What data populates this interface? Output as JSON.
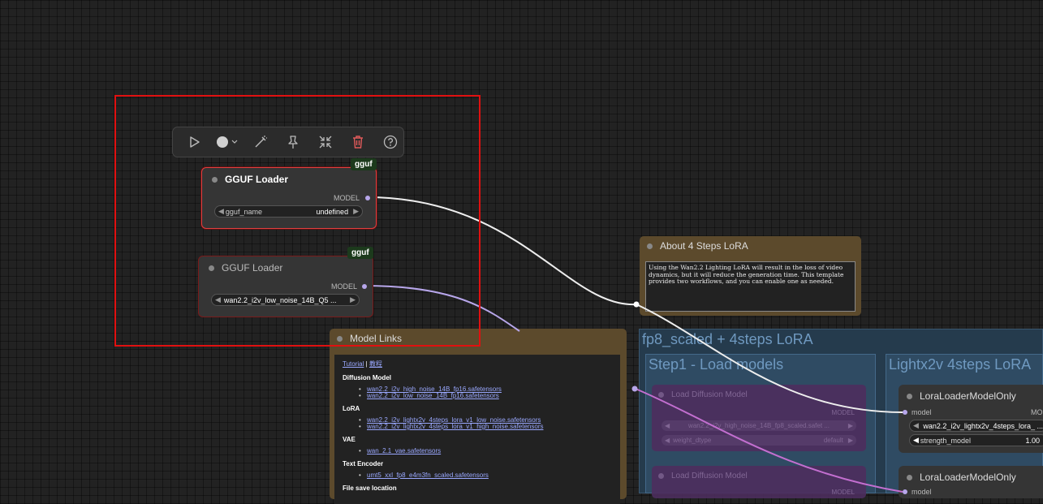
{
  "toolbar": {
    "run_icon": "play-icon",
    "color_icon": "color-dot-icon",
    "bypass_icon": "wand-icon",
    "pin_icon": "pin-icon",
    "collapse_icon": "collapse-icon",
    "delete_icon": "trash-icon",
    "help_icon": "help-icon"
  },
  "nodes": {
    "gguf1": {
      "badge": "gguf",
      "title": "GGUF Loader",
      "output": "MODEL",
      "widget_name": "gguf_name",
      "widget_value": "undefined"
    },
    "gguf2": {
      "badge": "gguf",
      "title": "GGUF Loader",
      "output": "MODEL",
      "widget_value": "wan2.2_i2v_low_noise_14B_Q5 ..."
    }
  },
  "about_note": {
    "title": "About 4 Steps LoRA",
    "text": "Using the Wan2.2 Lighting LoRA will result in the loss of video dynamics, but it will reduce the generation time. This template provides two workflows, and you can enable one as needed."
  },
  "model_links": {
    "title": "Model Links",
    "tutorial": "Tutorial",
    "sep": "|",
    "tutorial_cn": "教程",
    "sections": [
      {
        "heading": "Diffusion Model",
        "items": [
          "wan2.2_i2v_high_noise_14B_fp16.safetensors",
          "wan2.2_i2v_low_noise_14B_fp16.safetensors"
        ]
      },
      {
        "heading": "LoRA",
        "items": [
          "wan2.2_i2v_lightx2v_4steps_lora_v1_low_noise.safetensors",
          "wan2.2_i2v_lightx2v_4steps_lora_v1_high_noise.safetensors"
        ]
      },
      {
        "heading": "VAE",
        "items": [
          "wan_2.1_vae.safetensors"
        ]
      },
      {
        "heading": "Text Encoder",
        "items": [
          "umt5_xxl_fp8_e4m3fn_scaled.safetensors"
        ]
      },
      {
        "heading": "File save location",
        "items": []
      }
    ]
  },
  "group": {
    "title": "fp8_scaled + 4steps LoRA",
    "step1": {
      "title": "Step1 - Load models",
      "node1": {
        "title": "Load Diffusion Model",
        "output": "MODEL",
        "widget1": "wan2.2_i2v_high_noise_14B_fp8_scaled.safet ...",
        "widget2_name": "weight_dtype",
        "widget2_value": "default"
      },
      "node2": {
        "title": "Load Diffusion Model",
        "output": "MODEL"
      }
    },
    "lora_group": {
      "title": "Lightx2v 4steps LoRA",
      "node1": {
        "title": "LoraLoaderModelOnly",
        "input": "model",
        "output": "MO",
        "widget1": "wan2.2_i2v_lightx2v_4steps_lora_ ...",
        "widget2_name": "strength_model",
        "widget2_value": "1.00"
      },
      "node2": {
        "title": "LoraLoaderModelOnly",
        "input": "model"
      }
    }
  }
}
